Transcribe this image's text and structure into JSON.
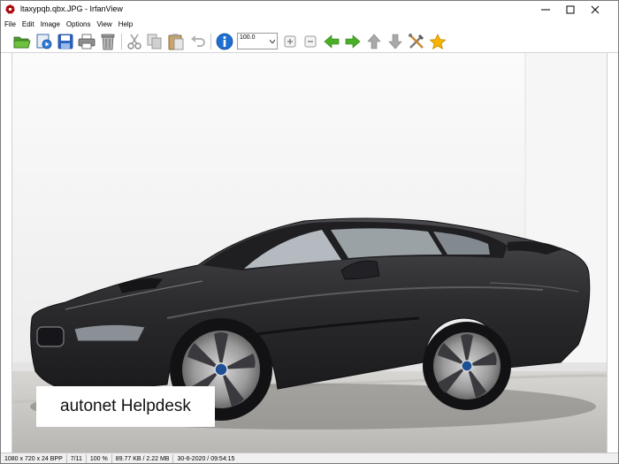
{
  "window": {
    "title": "ltaxypqb.qbx.JPG - IrfanView",
    "app_icon": "irfanview-icon",
    "controls": [
      "minimize-icon",
      "maximize-icon",
      "close-icon"
    ]
  },
  "menu": {
    "items": [
      {
        "label": "File"
      },
      {
        "label": "Edit"
      },
      {
        "label": "Image"
      },
      {
        "label": "Options"
      },
      {
        "label": "View"
      },
      {
        "label": "Help"
      }
    ]
  },
  "toolbar": {
    "buttons": [
      "open-folder-icon",
      "slideshow-icon",
      "save-icon",
      "print-icon",
      "delete-icon",
      "cut-icon",
      "copy-icon",
      "paste-icon",
      "undo-icon",
      "info-icon",
      "zoom-in-icon",
      "zoom-out-icon",
      "previous-icon",
      "next-icon",
      "first-icon",
      "last-icon",
      "settings-icon",
      "favorite-icon"
    ],
    "zoom_value": "100.0"
  },
  "image": {
    "watermark_text": "autonet Helpdesk"
  },
  "statusbar": {
    "dimensions": "1080 x 720 x 24 BPP",
    "position": "7/11",
    "zoom": "100 %",
    "size": "89.77 KB / 2.22 MB",
    "datetime": "30-6-2020 / 09:54:15"
  },
  "colors": {
    "accent_green": "#4caf28",
    "info_blue": "#1f6fd1",
    "star_yellow": "#f5b400",
    "car_body": "#2b2b2e"
  }
}
